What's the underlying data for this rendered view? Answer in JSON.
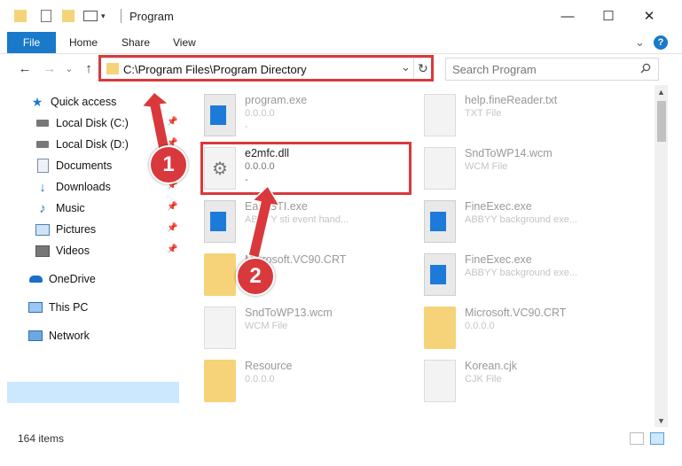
{
  "window": {
    "title": "Program",
    "minimize_glyph": "—",
    "maximize_glyph": "☐",
    "close_glyph": "✕"
  },
  "ribbon": {
    "tabs": [
      "File",
      "Home",
      "Share",
      "View"
    ],
    "help_glyph": "?",
    "expand_glyph": "⌄"
  },
  "address": {
    "path": "C:\\Program Files\\Program Directory",
    "dropdown_glyph": "⌄",
    "refresh_glyph": "↻"
  },
  "search": {
    "placeholder": "Search Program"
  },
  "nav": {
    "back_glyph": "←",
    "forward_glyph": "→",
    "recent_glyph": "⌄",
    "up_glyph": "↑",
    "items": [
      {
        "label": "Quick access",
        "icon": "star-icon"
      },
      {
        "label": "Local Disk (C:)",
        "icon": "drive-icon"
      },
      {
        "label": "Local Disk (D:)",
        "icon": "drive-icon"
      },
      {
        "label": "Documents",
        "icon": "documents-icon"
      },
      {
        "label": "Downloads",
        "icon": "download-icon"
      },
      {
        "label": "Music",
        "icon": "music-icon"
      },
      {
        "label": "Pictures",
        "icon": "pictures-icon"
      },
      {
        "label": "Videos",
        "icon": "videos-icon"
      },
      {
        "label": "OneDrive",
        "icon": "cloud-icon"
      },
      {
        "label": "This PC",
        "icon": "computer-icon"
      },
      {
        "label": "Network",
        "icon": "network-icon"
      }
    ]
  },
  "files": [
    {
      "name": "program.exe",
      "line1": "0.0.0.0",
      "line2": "-"
    },
    {
      "name": "help.fineReader.txt",
      "line1": "TXT File",
      "line2": ""
    },
    {
      "name": "e2mfc.dll",
      "line1": "0.0.0.0",
      "line2": "-"
    },
    {
      "name": "SndToWP14.wcm",
      "line1": "WCM File",
      "line2": ""
    },
    {
      "name": "EasySTI.exe",
      "line1": "ABBYY sti event hand...",
      "line2": ""
    },
    {
      "name": "FineExec.exe",
      "line1": "ABBYY background exe...",
      "line2": ""
    },
    {
      "name": "Microsoft.VC90.CRT",
      "line1": "",
      "line2": ""
    },
    {
      "name": "FineExec.exe",
      "line1": "ABBYY background exe...",
      "line2": ""
    },
    {
      "name": "SndToWP13.wcm",
      "line1": "WCM File",
      "line2": ""
    },
    {
      "name": "Microsoft.VC90.CRT",
      "line1": "0.0.0.0",
      "line2": ""
    },
    {
      "name": "Resource",
      "line1": "0.0.0.0",
      "line2": ""
    },
    {
      "name": "Korean.cjk",
      "line1": "CJK File",
      "line2": ""
    }
  ],
  "status": {
    "count": "164 items"
  },
  "callouts": [
    "1",
    "2"
  ],
  "colors": {
    "accent": "#1979ca",
    "highlight": "#d9393c",
    "selection": "#cce8ff"
  }
}
